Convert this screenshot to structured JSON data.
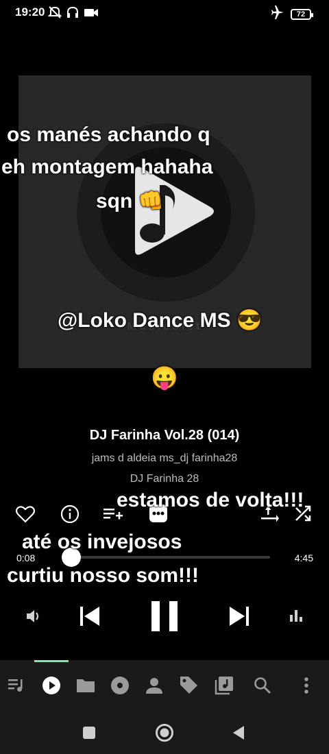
{
  "status_bar": {
    "time": "19:20",
    "battery": "72",
    "icons_left": [
      "mute-icon",
      "headset-icon",
      "video-icon"
    ],
    "icons_right": [
      "airplane-icon",
      "battery-icon"
    ]
  },
  "artwork": {
    "brand": "Musicolet"
  },
  "overlays": {
    "line1": "os manés achando q",
    "line2": "eh montagem hahaha",
    "line3": "sqn 👊",
    "handle": "@Loko Dance MS 😎",
    "emoji": "😛",
    "back": "estamos de volta!!!",
    "envious": "até os invejosos",
    "liked": "curtiu nosso som!!!"
  },
  "track": {
    "title": "DJ Farinha Vol.28 (014)",
    "artist": "jams d aldeia ms_dj farinha28",
    "album": "DJ Farinha 28"
  },
  "player": {
    "current_time": "0:08",
    "total_time": "4:45",
    "progress": 0.028
  },
  "tabs": [
    "queue-icon",
    "play-icon",
    "folder-icon",
    "album-icon",
    "artist-icon",
    "tag-icon",
    "playlist-icon",
    "search-icon",
    "more-icon"
  ],
  "accent_color": "#7ee8b3"
}
